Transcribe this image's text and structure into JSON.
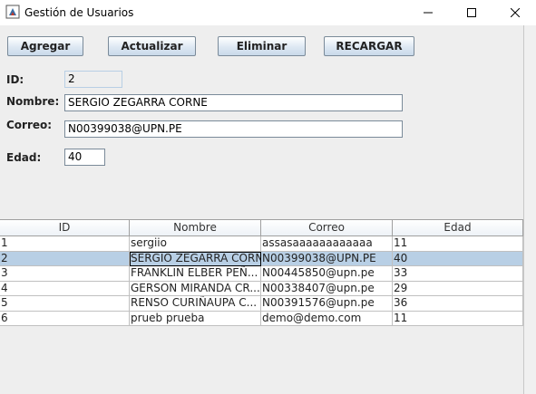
{
  "window": {
    "title": "Gestión de Usuarios"
  },
  "toolbar": {
    "add_label": "Agregar",
    "update_label": "Actualizar",
    "delete_label": "Eliminar",
    "reload_label": "RECARGAR"
  },
  "form": {
    "id_label": "ID:",
    "id_value": "2",
    "name_label": "Nombre:",
    "name_value": "SERGIO ZEGARRA CORNE",
    "email_label": "Correo:",
    "email_value": "N00399038@UPN.PE",
    "age_label": "Edad:",
    "age_value": "40"
  },
  "table": {
    "headers": [
      "ID",
      "Nombre",
      "Correo",
      "Edad"
    ],
    "rows": [
      [
        "1",
        "sergiio",
        "assasaaaaaaaaaaaa",
        "11"
      ],
      [
        "2",
        "SERGIO ZEGARRA CORNE",
        "N00399038@UPN.PE",
        "40"
      ],
      [
        "3",
        "FRANKLIN ELBER PEÑ...",
        "N00445850@upn.pe",
        "33"
      ],
      [
        "4",
        "GERSON MIRANDA CR...",
        "N00338407@upn.pe",
        "29"
      ],
      [
        "5",
        "RENSO CURIÑAUPA C...",
        "N00391576@upn.pe",
        "36"
      ],
      [
        "6",
        "prueb prueba",
        "demo@demo.com",
        "11"
      ]
    ],
    "selected_row": 1
  },
  "colors": {
    "selection": "#b8cfe5",
    "background": "#eeeeee"
  }
}
